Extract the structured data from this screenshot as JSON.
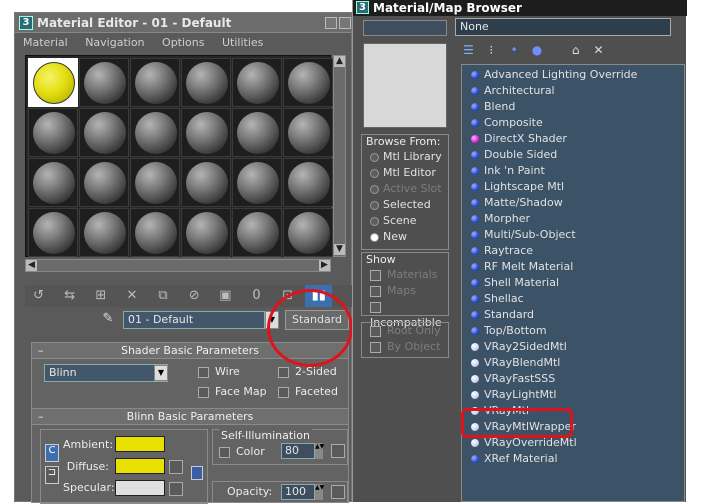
{
  "material_editor": {
    "title": "Material Editor - 01 - Default",
    "window_icon": "3ds-max-icon",
    "menu": [
      "Material",
      "Navigation",
      "Options",
      "Utilities"
    ],
    "toolbar_icons": [
      "get-material-icon",
      "put-to-scene-icon",
      "assign-to-selection-icon",
      "reset-icon",
      "make-copy-icon",
      "make-unique-icon",
      "put-to-library-icon",
      "material-id-icon",
      "show-map-icon",
      "show-end-result-icon",
      "go-to-parent-icon",
      "go-forward-icon"
    ],
    "material_id_label": "0",
    "material_name": "01 - Default",
    "material_type_button": "Standard",
    "shader_rollout": {
      "title": "Shader Basic Parameters",
      "shader": "Blinn",
      "options": [
        "Wire",
        "2-Sided",
        "Face Map",
        "Faceted"
      ]
    },
    "blinn_rollout": {
      "title": "Blinn Basic Parameters",
      "ambient_label": "Ambient:",
      "diffuse_label": "Diffuse:",
      "specular_label": "Specular:",
      "self_illum_label": "Self-Illumination",
      "color_label": "Color",
      "color_value": "80",
      "opacity_label": "Opacity:",
      "opacity_value": "100"
    },
    "colors": {
      "ambient": "#e8e000",
      "diffuse": "#e8e000",
      "specular": "#e0e0e0",
      "active_sphere": "#e6e010"
    }
  },
  "browser": {
    "title": "Material/Map Browser",
    "name_field": "None",
    "browse_from": {
      "title": "Browse From:",
      "options": [
        {
          "label": "Mtl Library",
          "selected": false,
          "enabled": true
        },
        {
          "label": "Mtl Editor",
          "selected": false,
          "enabled": true
        },
        {
          "label": "Active Slot",
          "selected": false,
          "enabled": false
        },
        {
          "label": "Selected",
          "selected": false,
          "enabled": true
        },
        {
          "label": "Scene",
          "selected": false,
          "enabled": true
        },
        {
          "label": "New",
          "selected": true,
          "enabled": true
        }
      ]
    },
    "show": {
      "title": "Show",
      "options": [
        {
          "label": "Materials",
          "enabled": false
        },
        {
          "label": "Maps",
          "enabled": false
        },
        {
          "label": "Incompatible",
          "enabled": true
        }
      ]
    },
    "extra_options": [
      "Root Only",
      "By Object"
    ],
    "materials": [
      {
        "label": "Advanced Lighting Override",
        "icon": "blue"
      },
      {
        "label": "Architectural",
        "icon": "blue"
      },
      {
        "label": "Blend",
        "icon": "blue"
      },
      {
        "label": "Composite",
        "icon": "blue"
      },
      {
        "label": "DirectX Shader",
        "icon": "pink"
      },
      {
        "label": "Double Sided",
        "icon": "blue"
      },
      {
        "label": "Ink 'n Paint",
        "icon": "blue"
      },
      {
        "label": "Lightscape Mtl",
        "icon": "blue"
      },
      {
        "label": "Matte/Shadow",
        "icon": "blue"
      },
      {
        "label": "Morpher",
        "icon": "blue"
      },
      {
        "label": "Multi/Sub-Object",
        "icon": "blue"
      },
      {
        "label": "Raytrace",
        "icon": "blue"
      },
      {
        "label": "RF Melt Material",
        "icon": "blue"
      },
      {
        "label": "Shell Material",
        "icon": "blue"
      },
      {
        "label": "Shellac",
        "icon": "blue"
      },
      {
        "label": "Standard",
        "icon": "blue"
      },
      {
        "label": "Top/Bottom",
        "icon": "blue"
      },
      {
        "label": "VRay2SidedMtl",
        "icon": "white"
      },
      {
        "label": "VRayBlendMtl",
        "icon": "white"
      },
      {
        "label": "VRayFastSSS",
        "icon": "white"
      },
      {
        "label": "VRayLightMtl",
        "icon": "white"
      },
      {
        "label": "VRayMtl",
        "icon": "white"
      },
      {
        "label": "VRayMtlWrapper",
        "icon": "white"
      },
      {
        "label": "VRayOverrideMtl",
        "icon": "white"
      },
      {
        "label": "XRef Material",
        "icon": "blue"
      }
    ]
  },
  "annotation_color": "#e0121c"
}
